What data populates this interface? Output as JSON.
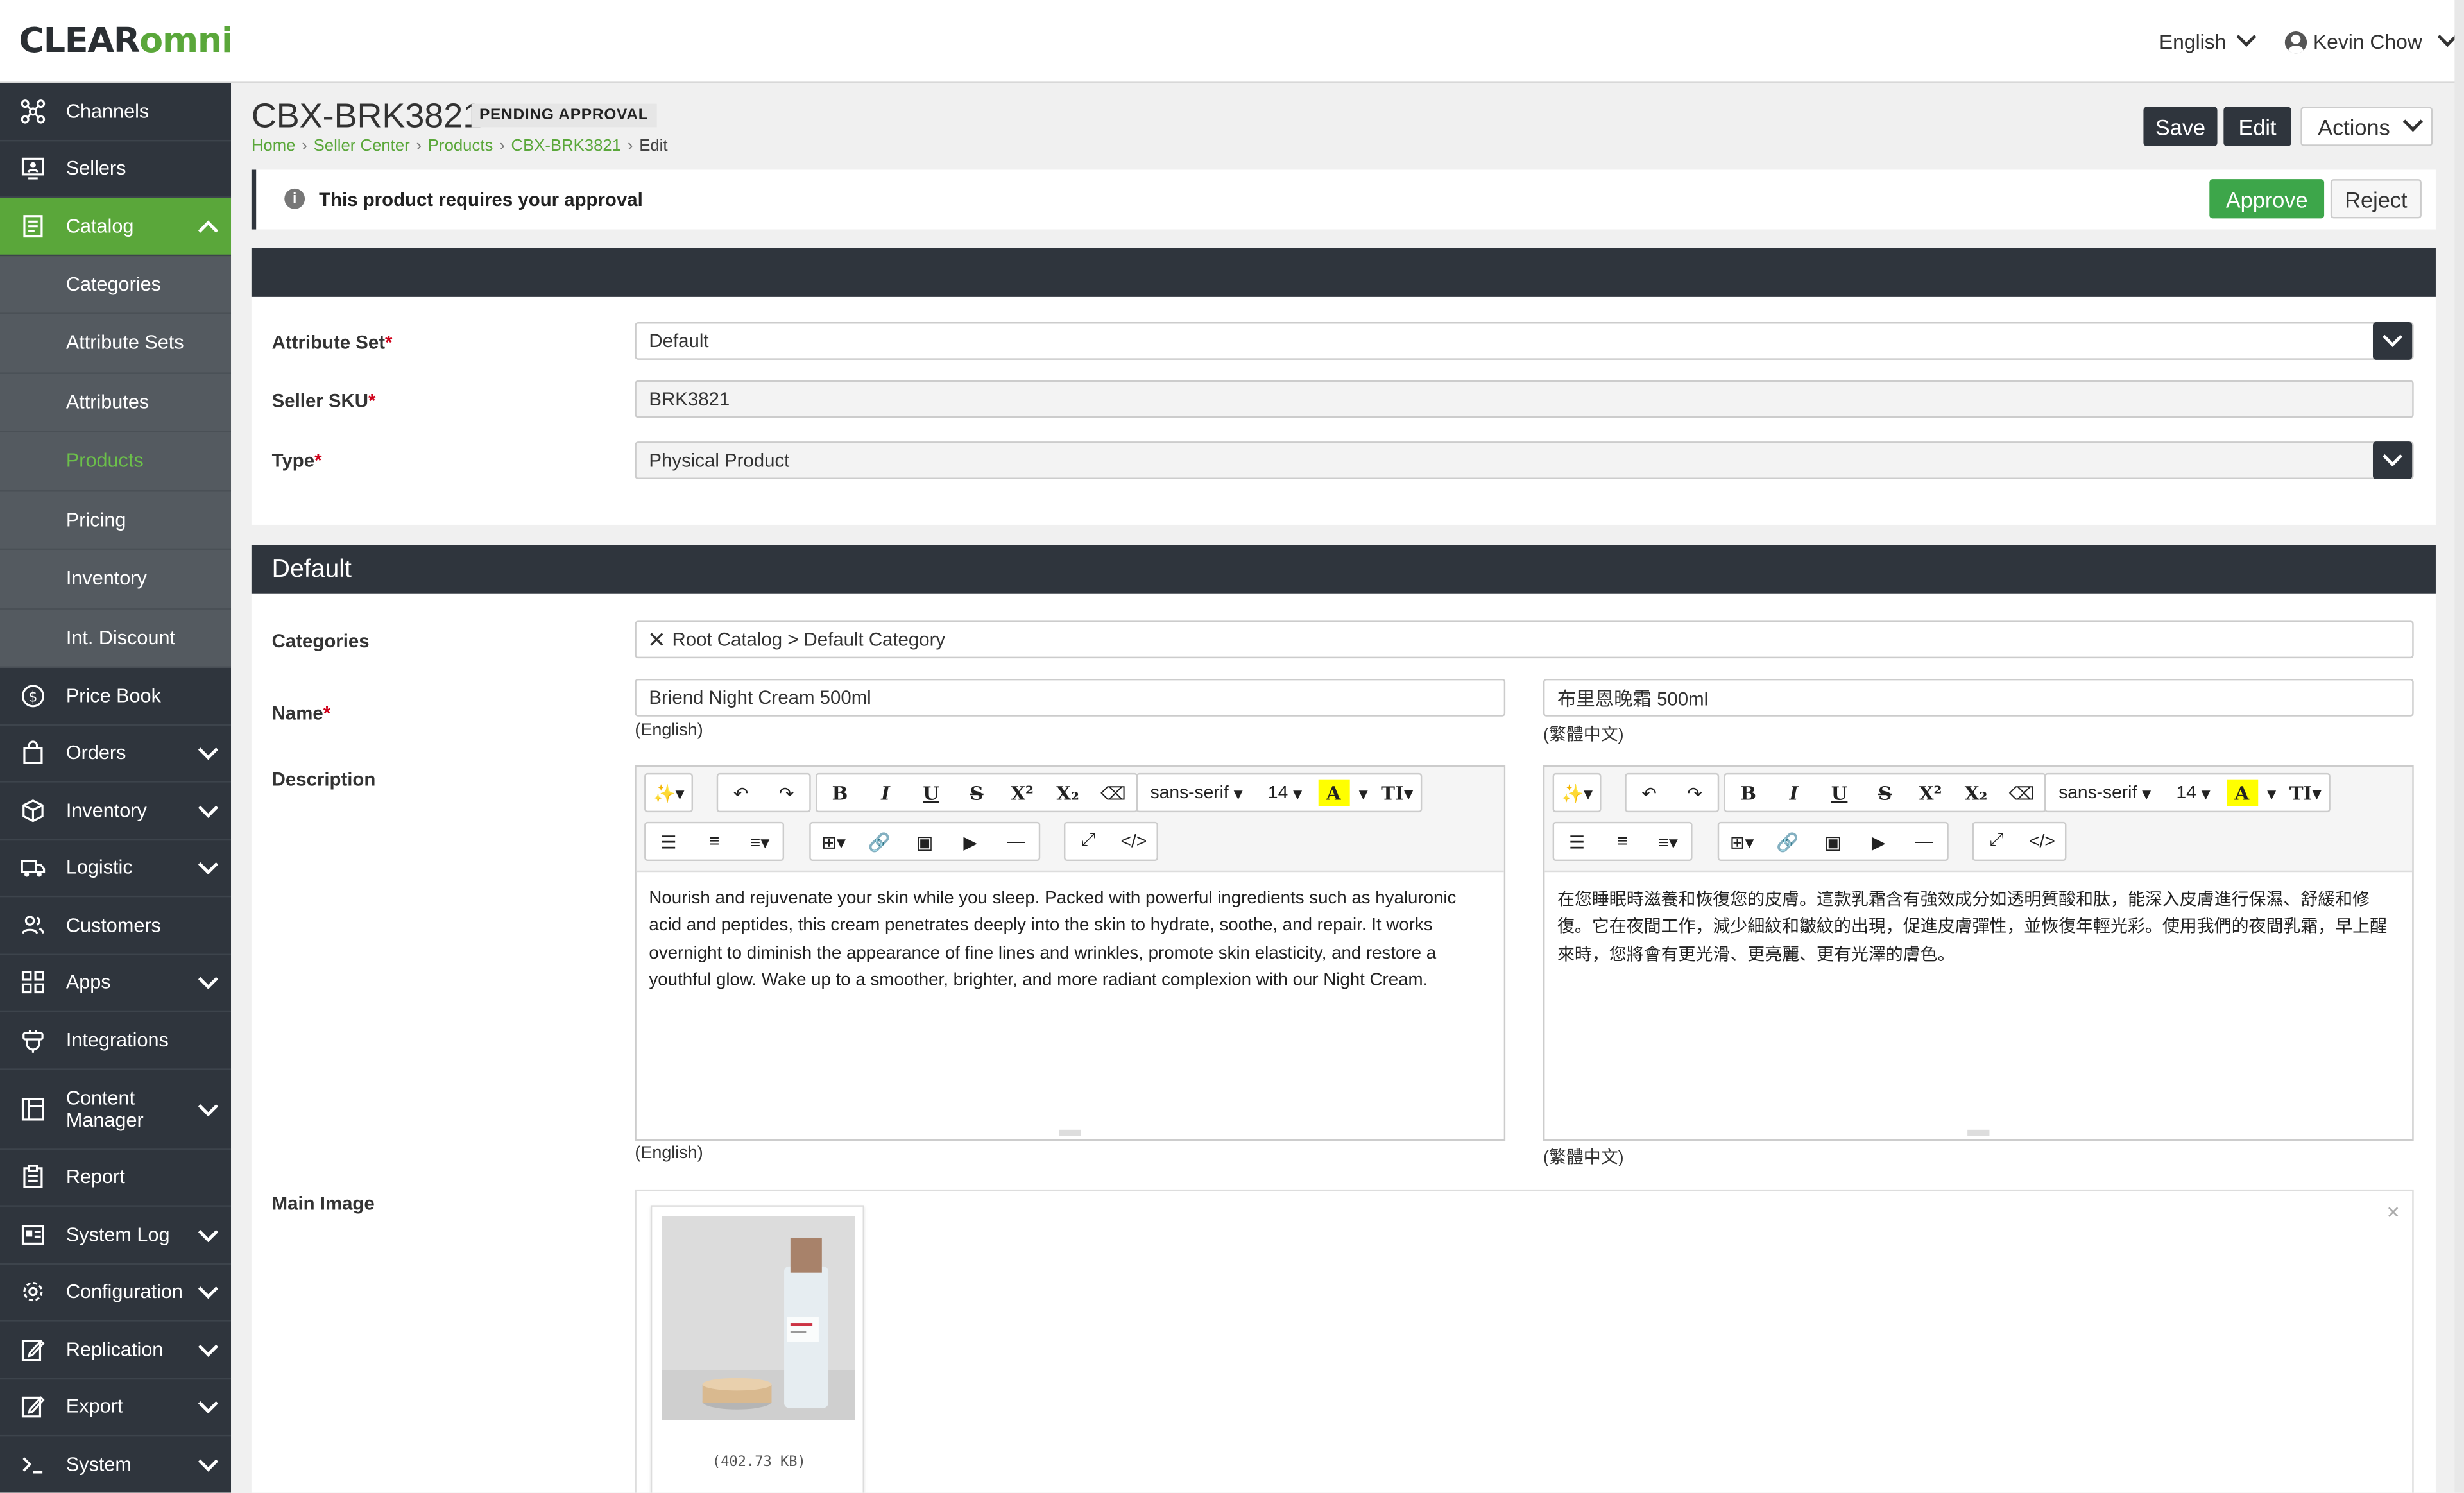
{
  "header": {
    "logo_clear": "CLEAR",
    "logo_omni": "omni",
    "language": "English",
    "user": "Kevin Chow"
  },
  "sidebar": {
    "items": [
      {
        "label": "Channels",
        "icon": "channels-icon"
      },
      {
        "label": "Sellers",
        "icon": "sellers-icon"
      },
      {
        "label": "Catalog",
        "icon": "catalog-icon",
        "expanded": true
      },
      {
        "label": "Price Book",
        "icon": "price-book-icon"
      },
      {
        "label": "Orders",
        "icon": "orders-icon"
      },
      {
        "label": "Inventory",
        "icon": "inventory-icon"
      },
      {
        "label": "Logistic",
        "icon": "logistic-icon"
      },
      {
        "label": "Customers",
        "icon": "customers-icon"
      },
      {
        "label": "Apps",
        "icon": "apps-icon"
      },
      {
        "label": "Integrations",
        "icon": "integrations-icon"
      },
      {
        "label": "Content Manager",
        "icon": "content-manager-icon"
      },
      {
        "label": "Report",
        "icon": "report-icon"
      },
      {
        "label": "System Log",
        "icon": "system-log-icon"
      },
      {
        "label": "Configuration",
        "icon": "gear-icon"
      },
      {
        "label": "Replication",
        "icon": "replication-icon"
      },
      {
        "label": "Export",
        "icon": "export-icon"
      },
      {
        "label": "System",
        "icon": "system-icon"
      }
    ],
    "catalog_sub": [
      "Categories",
      "Attribute Sets",
      "Attributes",
      "Products",
      "Pricing",
      "Inventory",
      "Int. Discount"
    ],
    "selected_sub": "Products",
    "accent": "#5aa73a"
  },
  "page": {
    "title": "CBX-BRK3821",
    "status": "PENDING APPROVAL",
    "breadcrumb": [
      "Home",
      "Seller Center",
      "Products",
      "CBX-BRK3821",
      "Edit"
    ],
    "save": "Save",
    "edit": "Edit",
    "actions": "Actions",
    "notice": "This product requires your approval",
    "approve": "Approve",
    "reject": "Reject"
  },
  "form": {
    "attribute_set_label": "Attribute Set",
    "attribute_set_value": "Default",
    "seller_sku_label": "Seller SKU",
    "seller_sku_value": "BRK3821",
    "type_label": "Type",
    "type_value": "Physical Product"
  },
  "default_section": {
    "title": "Default",
    "categories_label": "Categories",
    "categories_value": "Root Catalog > Default Category",
    "name_label": "Name",
    "name_en": "Briend Night Cream 500ml",
    "name_zh": "布里恩晚霜 500ml",
    "lang_en": "(English)",
    "lang_zh": "(繁體中文)",
    "description_label": "Description",
    "toolbar_font": "sans-serif",
    "toolbar_size": "14",
    "desc_en": "Nourish and rejuvenate your skin while you sleep. Packed with powerful ingredients such as hyaluronic acid and peptides, this cream penetrates deeply into the skin to hydrate, soothe, and repair. It works overnight to diminish the appearance of fine lines and wrinkles, promote skin elasticity, and restore a youthful glow. Wake up to a smoother, brighter, and more radiant complexion with our Night Cream.",
    "desc_zh": "在您睡眠時滋養和恢復您的皮膚。這款乳霜含有強效成分如透明質酸和肽，能深入皮膚進行保濕、舒緩和修復。它在夜間工作，減少細紋和皺紋的出現，促進皮膚彈性，並恢復年輕光彩。使用我們的夜間乳霜，早上醒來時，您將會有更光滑、更亮麗、更有光澤的膚色。",
    "main_image_label": "Main Image",
    "image_size": "(402.73 KB)",
    "close_glyph": "×"
  }
}
